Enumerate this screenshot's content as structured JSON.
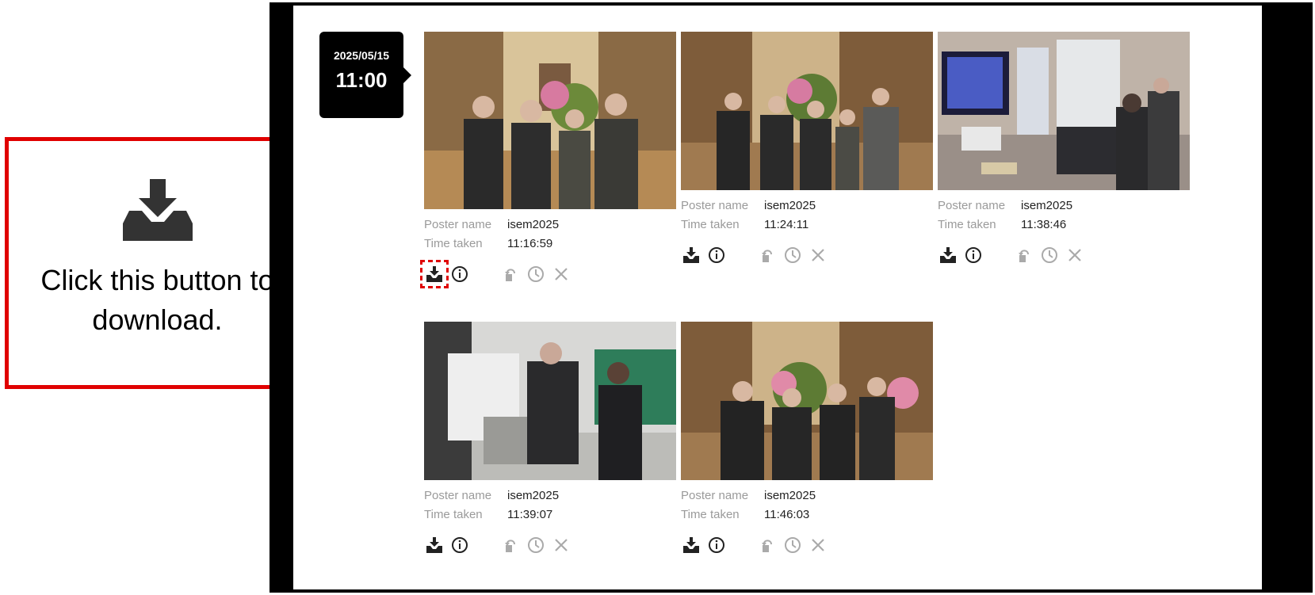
{
  "timestamp": {
    "date": "2025/05/15",
    "time": "11:00"
  },
  "meta_labels": {
    "poster": "Poster name",
    "time": "Time taken"
  },
  "photos": [
    {
      "poster": "isem2025",
      "time": "11:16:59"
    },
    {
      "poster": "isem2025",
      "time": "11:24:11"
    },
    {
      "poster": "isem2025",
      "time": "11:38:46"
    },
    {
      "poster": "isem2025",
      "time": "11:39:07"
    },
    {
      "poster": "isem2025",
      "time": "11:46:03"
    }
  ],
  "callout": {
    "text": "Click this button to download."
  },
  "icons": [
    "download-icon",
    "info-icon",
    "restore-icon",
    "clock-icon",
    "close-icon"
  ],
  "colors": {
    "callout_border": "#e00000",
    "label": "#9a9a9a",
    "bubble": "#000000"
  }
}
